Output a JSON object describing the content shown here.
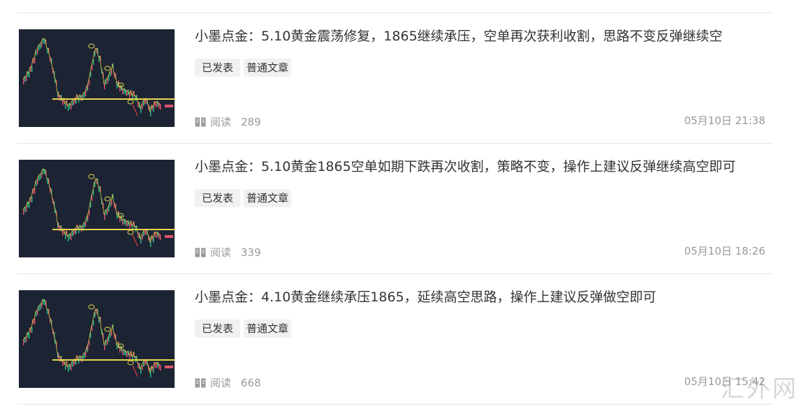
{
  "articles": [
    {
      "title": "小墨点金：5.10黄金震荡修复，1865继续承压，空单再次获利收割，思路不变反弹继续空",
      "status_tag": "已发表",
      "type_tag": "普通文章",
      "read_label": "阅读",
      "read_count": "289",
      "date": "05月10日 21:38"
    },
    {
      "title": "小墨点金：5.10黄金1865空单如期下跌再次收割，策略不变，操作上建议反弹继续高空即可",
      "status_tag": "已发表",
      "type_tag": "普通文章",
      "read_label": "阅读",
      "read_count": "339",
      "date": "05月10日 18:26"
    },
    {
      "title": "小墨点金：4.10黄金继续承压1865，延续高空思路，操作上建议反弹做空即可",
      "status_tag": "已发表",
      "type_tag": "普通文章",
      "read_label": "阅读",
      "read_count": "668",
      "date": "05月10日 15:42"
    }
  ],
  "watermark": "汇外网",
  "colors": {
    "thumb_bg": "#1c2333",
    "support_line": "#e8d84a",
    "tag_bg": "#f1f1f1",
    "meta_text": "#999999"
  }
}
